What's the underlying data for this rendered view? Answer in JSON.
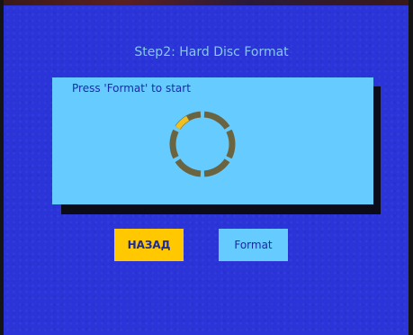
{
  "title": "Step2: Hard Disc Format",
  "panel": {
    "instruction": "Press 'Format' to start",
    "progress_fraction": 0.12
  },
  "buttons": {
    "back_label": "НАЗАД",
    "format_label": "Format"
  },
  "colors": {
    "background": "#2a34d8",
    "panel": "#66ccff",
    "title_text": "#86c8ee",
    "accent_yellow": "#ffc800",
    "ring_segment": "#6b6440",
    "ring_active": "#f0c020",
    "button_text": "#1a2aa0"
  },
  "icons": {
    "progress": "progress-ring-icon"
  }
}
